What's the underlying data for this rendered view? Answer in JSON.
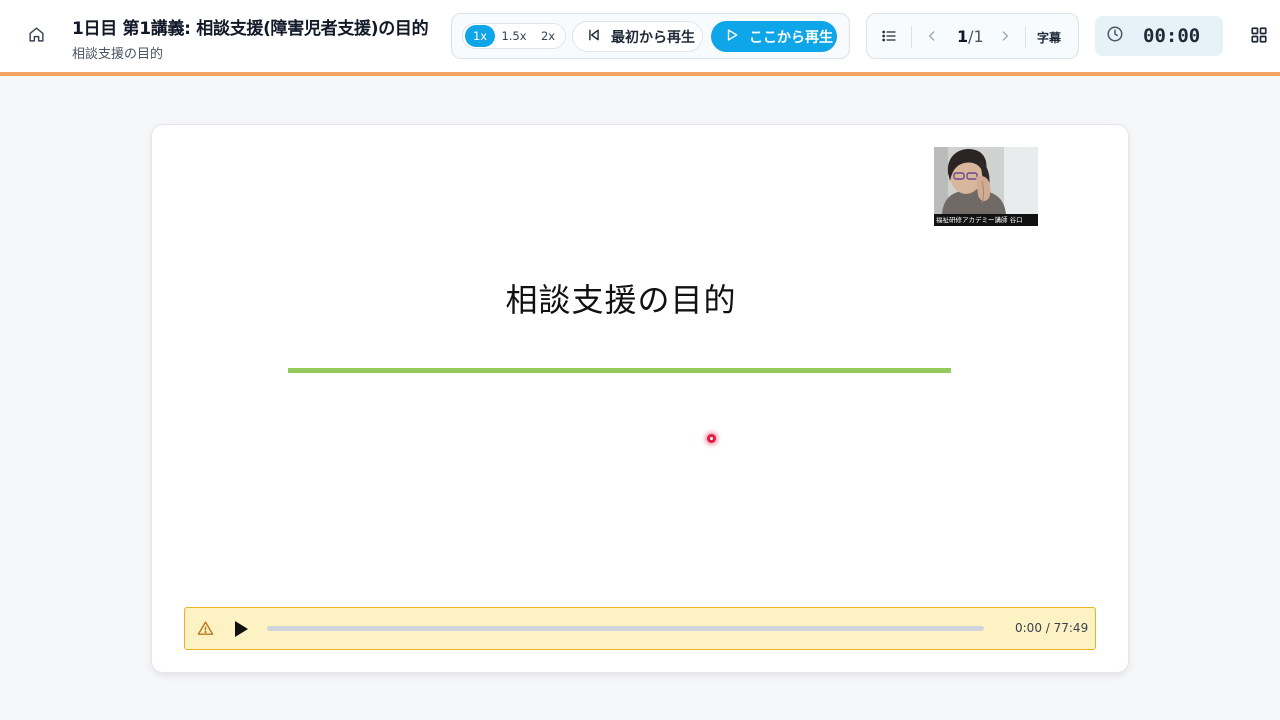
{
  "header": {
    "title": "1日目 第1講義: 相談支援(障害児者支援)の目的",
    "subtitle": "相談支援の目的"
  },
  "playback": {
    "speeds": [
      "1x",
      "1.5x",
      "2x"
    ],
    "active_speed": "1x",
    "restart_label": "最初から再生",
    "play_here_label": "ここから再生"
  },
  "navigation": {
    "current_page": "1",
    "page_total": "/1",
    "subtitles_label": "字幕"
  },
  "timer": {
    "value": "00:00"
  },
  "slide": {
    "title": "相談支援の目的",
    "webcam_caption": "福祉研修アカデミー講師 谷口"
  },
  "audio": {
    "time": "0:00 / 77:49",
    "progress": 0
  },
  "colors": {
    "accent": "#0ea5e9",
    "header_line": "#f4a261",
    "slide_line": "#94c95b",
    "audio_bg": "#fdf2c4",
    "audio_border": "#e7b521"
  },
  "icons": {
    "home": "home-icon",
    "restart": "skip-back-icon",
    "play_here": "play-outline-icon",
    "list": "list-icon",
    "prev": "chevron-left-icon",
    "next": "chevron-right-icon",
    "timer": "clock-icon",
    "layout": "grid-icon",
    "warning": "warning-icon",
    "audio_play": "play-icon"
  }
}
